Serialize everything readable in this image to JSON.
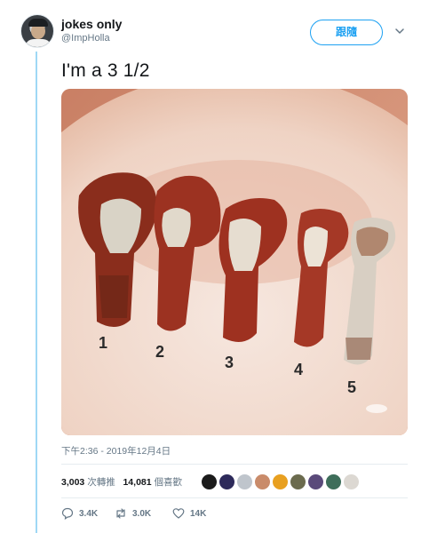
{
  "author": {
    "display_name": "jokes only",
    "handle": "@ImpHolla"
  },
  "follow_button": {
    "label": "跟隨"
  },
  "tweet": {
    "text": "I'm a 3 1/2",
    "timestamp": "下午2:36 - 2019年12月4日"
  },
  "image": {
    "number_labels": [
      "1",
      "2",
      "3",
      "4",
      "5"
    ]
  },
  "stats": {
    "retweets_count": "3,003",
    "retweets_label": "次轉推",
    "likes_count": "14,081",
    "likes_label": "個喜歡"
  },
  "liker_colors": [
    "#1b1b1b",
    "#2d2a5a",
    "#bfc5cc",
    "#c98b6a",
    "#e8a020",
    "#6b6b4e",
    "#5a4a7a",
    "#3e6e5a",
    "#dcd8d2"
  ],
  "actions": {
    "reply_count": "3.4K",
    "retweet_count": "3.0K",
    "like_count": "14K"
  },
  "colors": {
    "accent": "#1da1f2",
    "thread_line": "#9fd8f5",
    "muted_text": "#657786"
  }
}
